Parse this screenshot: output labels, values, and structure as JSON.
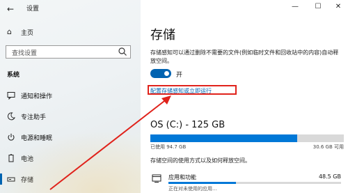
{
  "window": {
    "title": "设置",
    "controls": {
      "minimize": "—",
      "maximize": "☐",
      "close": "✕"
    }
  },
  "sidebar": {
    "home_label": "主页",
    "search_placeholder": "查找设置",
    "section_header": "系统",
    "items": [
      {
        "label": "通知和操作",
        "icon": "message-icon",
        "active": false
      },
      {
        "label": "专注助手",
        "icon": "moon-icon",
        "active": false
      },
      {
        "label": "电源和睡眠",
        "icon": "power-icon",
        "active": false
      },
      {
        "label": "电池",
        "icon": "battery-icon",
        "active": false
      },
      {
        "label": "存储",
        "icon": "storage-icon",
        "active": true
      }
    ]
  },
  "main": {
    "title": "存储",
    "description": "存储感知可以通过删除不需要的文件(例如临时文件和回收站中的内容)自动释放空间。",
    "toggle": {
      "label": "开",
      "on": true
    },
    "config_link": "配置存储感知或立即运行",
    "drive": {
      "title": "OS (C:) - 125 GB",
      "used_label": "已使用 94.7 GB",
      "free_label": "30.6 GB 可用",
      "used_fraction": 0.758
    },
    "usage_note": "存储空间的使用方式以及如何释放空间。",
    "categories": [
      {
        "name": "应用和功能",
        "size": "48.5 GB",
        "fraction": 0.39,
        "sub": "正在对未使用的应用…"
      }
    ]
  },
  "colors": {
    "accent": "#0063b1",
    "highlight": "#e0221b"
  }
}
